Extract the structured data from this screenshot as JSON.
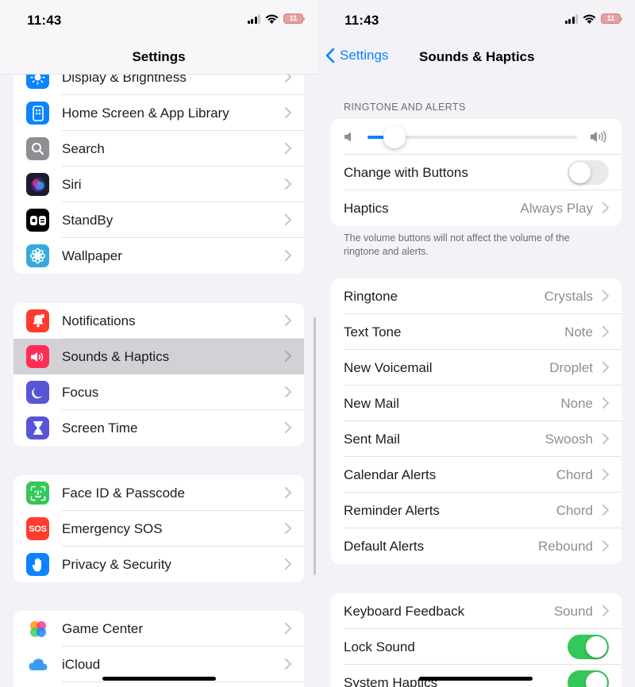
{
  "left": {
    "status": {
      "time": "11:43",
      "battery": "11"
    },
    "nav_title": "Settings",
    "groups": [
      {
        "items": [
          {
            "label": "Display & Brightness",
            "icon": "sun-icon",
            "color": "#0a84ff"
          },
          {
            "label": "Home Screen & App Library",
            "icon": "phone-grid-icon",
            "color": "#0a84ff"
          },
          {
            "label": "Search",
            "icon": "magnifier-icon",
            "color": "#8e8e93"
          },
          {
            "label": "Siri",
            "icon": "siri-orb-icon",
            "color": "#222233"
          },
          {
            "label": "StandBy",
            "icon": "standby-icon",
            "color": "#000000"
          },
          {
            "label": "Wallpaper",
            "icon": "flower-icon",
            "color": "#34aadc"
          }
        ]
      },
      {
        "items": [
          {
            "label": "Notifications",
            "icon": "bell-icon",
            "color": "#ff3b30"
          },
          {
            "label": "Sounds & Haptics",
            "icon": "speaker-icon",
            "color": "#ff2d55",
            "selected": true
          },
          {
            "label": "Focus",
            "icon": "moon-icon",
            "color": "#5856d6"
          },
          {
            "label": "Screen Time",
            "icon": "hourglass-icon",
            "color": "#5856d6"
          }
        ]
      },
      {
        "items": [
          {
            "label": "Face ID & Passcode",
            "icon": "face-id-icon",
            "color": "#34c759"
          },
          {
            "label": "Emergency SOS",
            "icon": "sos-icon",
            "color": "#ff3b30",
            "glyph": "SOS"
          },
          {
            "label": "Privacy & Security",
            "icon": "hand-icon",
            "color": "#0a84ff"
          }
        ]
      },
      {
        "items": [
          {
            "label": "Game Center",
            "icon": "game-center-icon",
            "color": "#ffffff"
          },
          {
            "label": "iCloud",
            "icon": "cloud-icon",
            "color": "#ffffff"
          }
        ]
      }
    ]
  },
  "right": {
    "status": {
      "time": "11:43",
      "battery": "11"
    },
    "back_label": "Settings",
    "nav_title": "Sounds & Haptics",
    "ringtone_header": "RINGTONE AND ALERTS",
    "volume_level": 0.13,
    "change_with_buttons": {
      "label": "Change with Buttons",
      "on": false
    },
    "haptics": {
      "label": "Haptics",
      "value": "Always Play"
    },
    "footer": "The volume buttons will not affect the volume of the ringtone and alerts.",
    "sounds": [
      {
        "label": "Ringtone",
        "value": "Crystals"
      },
      {
        "label": "Text Tone",
        "value": "Note"
      },
      {
        "label": "New Voicemail",
        "value": "Droplet"
      },
      {
        "label": "New Mail",
        "value": "None"
      },
      {
        "label": "Sent Mail",
        "value": "Swoosh"
      },
      {
        "label": "Calendar Alerts",
        "value": "Chord"
      },
      {
        "label": "Reminder Alerts",
        "value": "Chord"
      },
      {
        "label": "Default Alerts",
        "value": "Rebound"
      }
    ],
    "keyboard_feedback": {
      "label": "Keyboard Feedback",
      "value": "Sound"
    },
    "lock_sound": {
      "label": "Lock Sound",
      "on": true
    },
    "system_haptics": {
      "label": "System Haptics",
      "on": true
    }
  }
}
